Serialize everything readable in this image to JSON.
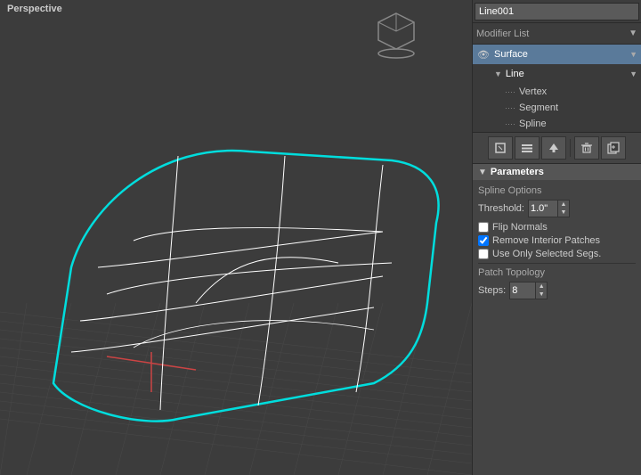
{
  "viewport": {
    "label": "Perspective"
  },
  "right_panel": {
    "object_name": "Line001",
    "modifier_list_label": "Modifier List",
    "modifiers": [
      {
        "id": "surface",
        "name": "Surface",
        "active": true,
        "has_eye": true
      },
      {
        "id": "line",
        "name": "Line",
        "active": false,
        "has_eye": false
      }
    ],
    "sub_items": [
      {
        "id": "vertex",
        "name": "Vertex"
      },
      {
        "id": "segment",
        "name": "Segment"
      },
      {
        "id": "spline",
        "name": "Spline"
      }
    ],
    "toolbar": {
      "buttons": [
        "⊞",
        "↑",
        "|",
        "🗑",
        "📋"
      ]
    },
    "parameters": {
      "title": "Parameters",
      "spline_options_label": "Spline Options",
      "threshold_label": "Threshold:",
      "threshold_value": "1.0\"",
      "flip_normals_label": "Flip Normals",
      "flip_normals_checked": false,
      "remove_interior_label": "Remove Interior Patches",
      "remove_interior_checked": true,
      "use_selected_label": "Use Only Selected Segs.",
      "use_selected_checked": false,
      "patch_topology_label": "Patch Topology",
      "steps_label": "Steps:",
      "steps_value": "8"
    }
  }
}
